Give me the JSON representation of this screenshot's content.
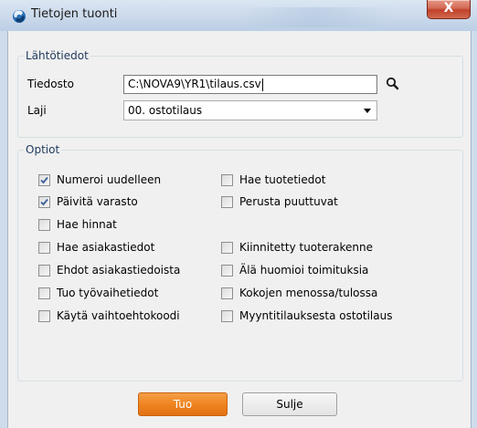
{
  "window": {
    "title": "Tietojen tuonti",
    "close_glyph": "X"
  },
  "source": {
    "legend": "Lähtötiedot",
    "file_label": "Tiedosto",
    "file_value": "C:\\NOVA9\\YR1\\tilaus.csv",
    "type_label": "Laji",
    "type_value": "00. ostotilaus"
  },
  "options": {
    "legend": "Optiot",
    "left": [
      {
        "label": "Numeroi uudelleen",
        "checked": true
      },
      {
        "label": "Päivitä varasto",
        "checked": true
      },
      {
        "label": "Hae hinnat",
        "checked": false
      },
      {
        "label": "Hae asiakastiedot",
        "checked": false
      },
      {
        "label": "Ehdot asiakastiedoista",
        "checked": false
      },
      {
        "label": "Tuo työvaihetiedot",
        "checked": false
      },
      {
        "label": "Käytä vaihtoehtokoodi",
        "checked": false
      }
    ],
    "right": [
      {
        "label": "Hae tuotetiedot",
        "checked": false
      },
      {
        "label": "Perusta puuttuvat",
        "checked": false
      },
      {
        "label": "Kiinnitetty tuoterakenne",
        "checked": false
      },
      {
        "label": "Älä huomioi toimituksia",
        "checked": false
      },
      {
        "label": "Kokojen menossa/tulossa",
        "checked": false
      },
      {
        "label": "Myyntitilauksesta ostotilaus",
        "checked": false
      }
    ]
  },
  "buttons": {
    "import_label": "Tuo",
    "close_label": "Sulje"
  },
  "colors": {
    "accent_orange": "#ef8420",
    "legend_blue": "#1e395b"
  }
}
